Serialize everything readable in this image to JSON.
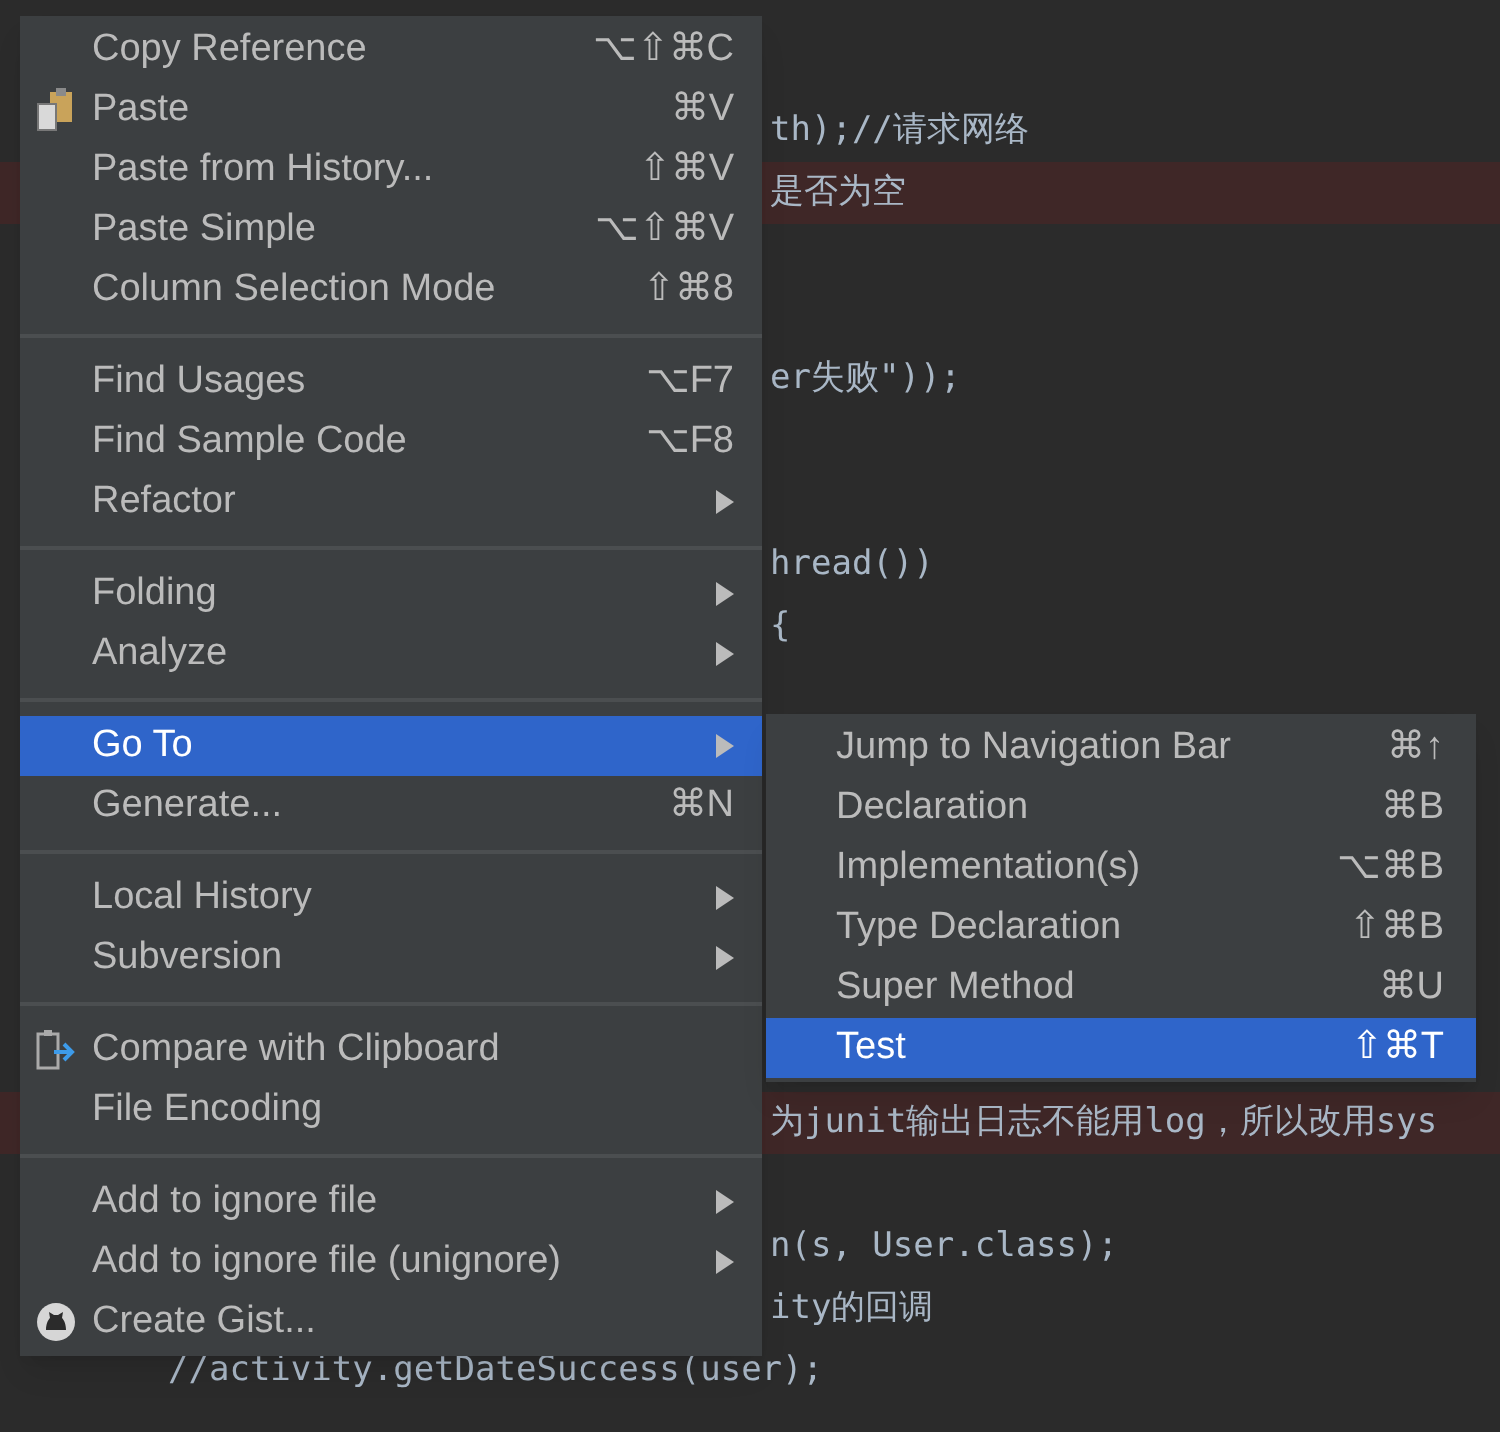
{
  "code_lines": [
    {
      "text": "th);//请求网络",
      "highlighted": false
    },
    {
      "text": "是否为空",
      "highlighted": true
    },
    {
      "text": "er失败\"));",
      "highlighted": false
    },
    {
      "text": "hread())",
      "highlighted": false
    },
    {
      "text": "{",
      "highlighted": false
    },
    {
      "text": "为junit输出日志不能用log，所以改用sys",
      "highlighted": true
    },
    {
      "text": "n(s, User.class);",
      "highlighted": false
    },
    {
      "text": "ity的回调",
      "highlighted": false
    },
    {
      "text": "//activity.getDateSuccess(user);",
      "highlighted": false,
      "kind": "full"
    }
  ],
  "context_menu": {
    "items": [
      {
        "kind": "item",
        "label": "Copy Reference",
        "shortcut": "⌥⇧⌘C",
        "submenu": false,
        "selected": false
      },
      {
        "kind": "item",
        "label": "Paste",
        "shortcut": "⌘V",
        "submenu": false,
        "selected": false
      },
      {
        "kind": "item",
        "label": "Paste from History...",
        "shortcut": "⇧⌘V",
        "submenu": false,
        "selected": false
      },
      {
        "kind": "item",
        "label": "Paste Simple",
        "shortcut": "⌥⇧⌘V",
        "submenu": false,
        "selected": false
      },
      {
        "kind": "item",
        "label": "Column Selection Mode",
        "shortcut": "⇧⌘8",
        "submenu": false,
        "selected": false
      },
      {
        "kind": "separator"
      },
      {
        "kind": "item",
        "label": "Find Usages",
        "shortcut": "⌥F7",
        "submenu": false,
        "selected": false
      },
      {
        "kind": "item",
        "label": "Find Sample Code",
        "shortcut": "⌥F8",
        "submenu": false,
        "selected": false
      },
      {
        "kind": "item",
        "label": "Refactor",
        "submenu": true,
        "selected": false
      },
      {
        "kind": "separator"
      },
      {
        "kind": "item",
        "label": "Folding",
        "submenu": true,
        "selected": false
      },
      {
        "kind": "item",
        "label": "Analyze",
        "submenu": true,
        "selected": false
      },
      {
        "kind": "separator"
      },
      {
        "kind": "item",
        "label": "Go To",
        "submenu": true,
        "selected": true
      },
      {
        "kind": "item",
        "label": "Generate...",
        "shortcut": "⌘N",
        "submenu": false,
        "selected": false
      },
      {
        "kind": "separator"
      },
      {
        "kind": "item",
        "label": "Local History",
        "submenu": true,
        "selected": false
      },
      {
        "kind": "item",
        "label": "Subversion",
        "submenu": true,
        "selected": false
      },
      {
        "kind": "separator"
      },
      {
        "kind": "item",
        "label": "Compare with Clipboard",
        "submenu": false,
        "selected": false
      },
      {
        "kind": "item",
        "label": "File Encoding",
        "submenu": false,
        "selected": false
      },
      {
        "kind": "separator"
      },
      {
        "kind": "item",
        "label": "Add to ignore file",
        "submenu": true,
        "selected": false
      },
      {
        "kind": "item",
        "label": "Add to ignore file (unignore)",
        "submenu": true,
        "selected": false
      },
      {
        "kind": "item",
        "label": "Create Gist...",
        "submenu": false,
        "selected": false
      }
    ]
  },
  "submenu": {
    "items": [
      {
        "label": "Jump to Navigation Bar",
        "shortcut": "⌘↑",
        "selected": false
      },
      {
        "label": "Declaration",
        "shortcut": "⌘B",
        "selected": false
      },
      {
        "label": "Implementation(s)",
        "shortcut": "⌥⌘B",
        "selected": false
      },
      {
        "label": "Type Declaration",
        "shortcut": "⇧⌘B",
        "selected": false
      },
      {
        "label": "Super Method",
        "shortcut": "⌘U",
        "selected": false
      },
      {
        "label": "Test",
        "shortcut": "⇧⌘T",
        "selected": true
      }
    ]
  }
}
